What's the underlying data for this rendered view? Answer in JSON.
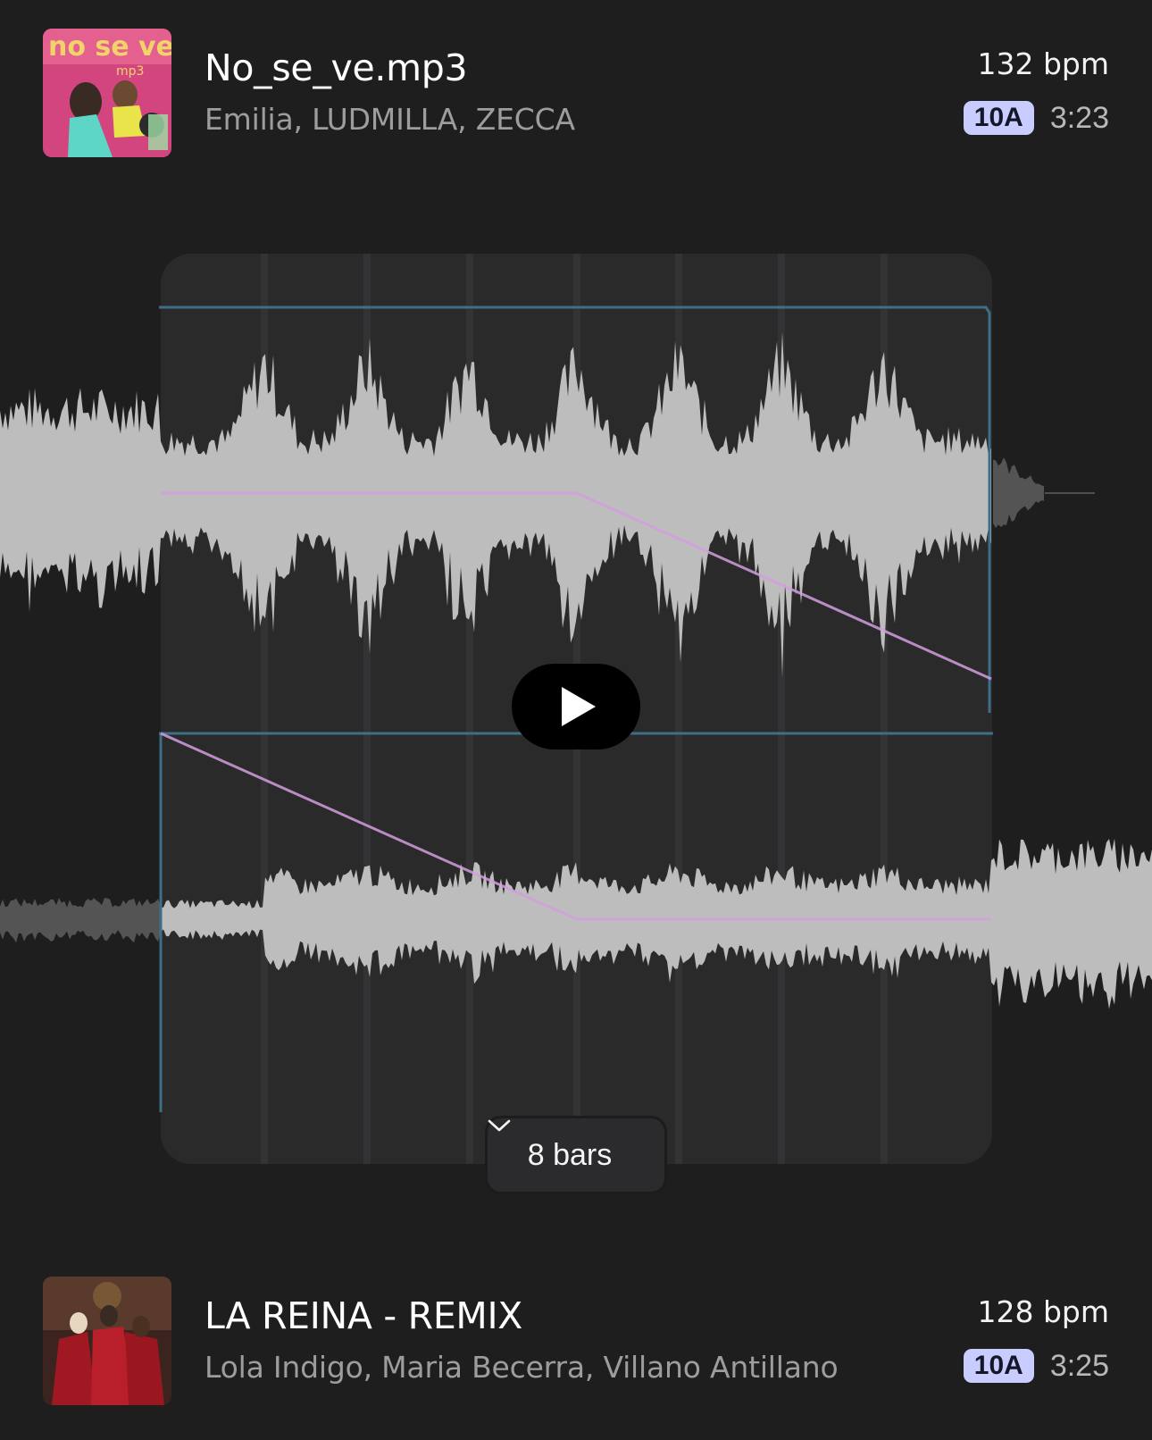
{
  "tracks": [
    {
      "title": "No_se_ve.mp3",
      "artists": "Emilia, LUDMILLA, ZECCA",
      "bpm": "132 bpm",
      "key": "10A",
      "duration": "3:23",
      "cover_text": "no se ve",
      "cover_sub": "mp3"
    },
    {
      "title": "LA REINA - REMIX",
      "artists": "Lola Indigo, Maria Becerra, Villano Antillano",
      "bpm": "128 bpm",
      "key": "10A",
      "duration": "3:25"
    }
  ],
  "transition": {
    "length_label": "8 bars"
  },
  "colors": {
    "background": "#1e1e1f",
    "panel": "#2a2a2b",
    "waveform": "#bdbdbd",
    "waveform_dim": "#545454",
    "fade_line": "#d49de0",
    "region_outline": "#3f6f86",
    "key_badge": "#c9ccff"
  },
  "icons": {
    "play": "play-icon",
    "dropdown": "chevron-down-icon"
  }
}
